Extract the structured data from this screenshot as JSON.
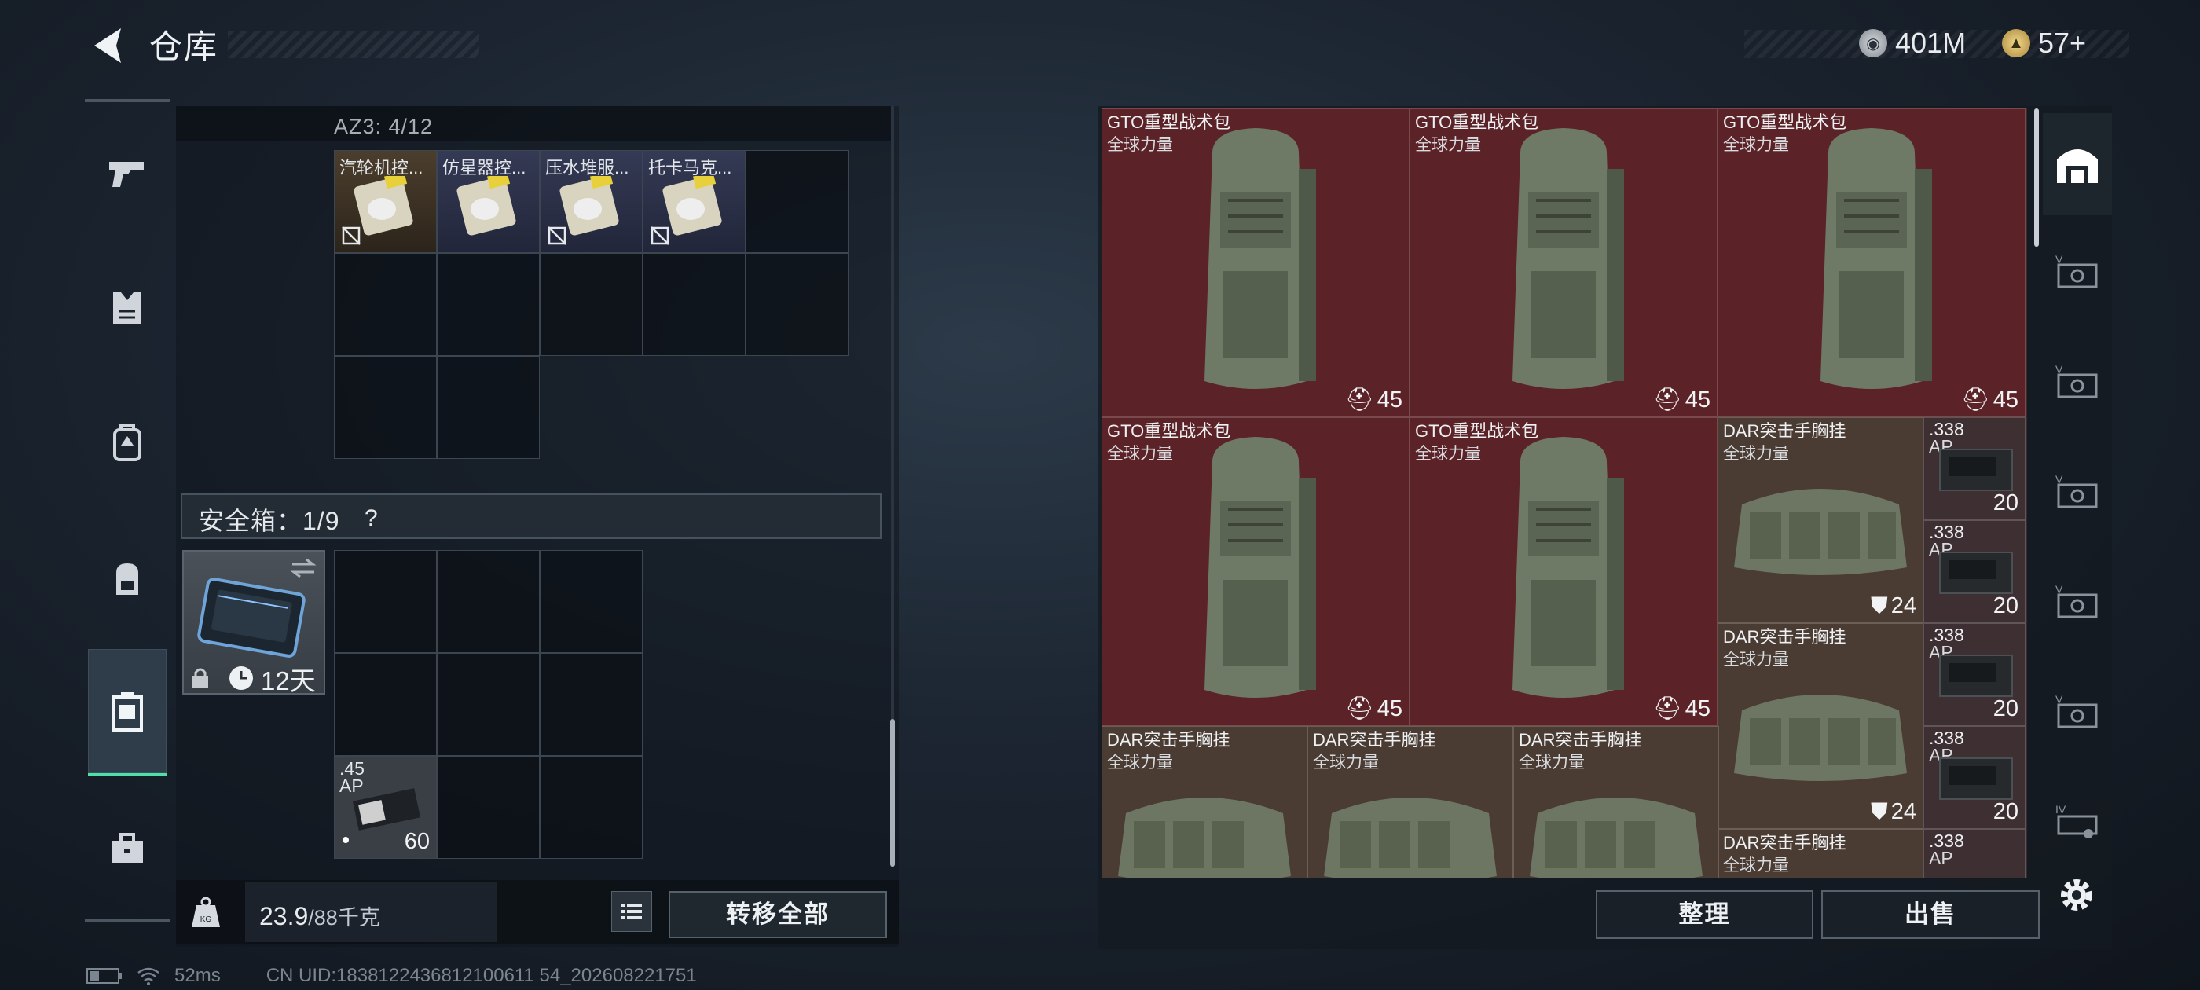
{
  "header": {
    "title": "仓库",
    "currency_coin": "401M",
    "currency_ticket": "57+"
  },
  "left_rail": {
    "items": [
      {
        "icon": "gun-icon"
      },
      {
        "icon": "vest-icon"
      },
      {
        "icon": "rig-icon"
      },
      {
        "icon": "backpack-icon"
      },
      {
        "icon": "case-icon",
        "active": true
      },
      {
        "icon": "toolbox-icon"
      }
    ]
  },
  "container": {
    "label": "AZ3: 4/12",
    "items": [
      {
        "name": "汽轮机控..."
      },
      {
        "name": "仿星器控..."
      },
      {
        "name": "压水堆服..."
      },
      {
        "name": "托卡马克..."
      }
    ]
  },
  "safebox": {
    "label": "安全箱：1/9",
    "help": "?",
    "days": "12天",
    "ammo_name": ".45",
    "ammo_sub": "AP",
    "ammo_count": "60"
  },
  "weight": {
    "current": "23.9",
    "max": "/88千克"
  },
  "buttons": {
    "transfer_all": "转移全部",
    "sort": "整理",
    "sell": "出售"
  },
  "stash": {
    "gto_name": "GTO重型战术包",
    "gto_sub": "全球力量",
    "gto_count": "45",
    "dar_name": "DAR突击手胸挂",
    "dar_sub": "全球力量",
    "dar_count": "24",
    "ammo_name": ".338",
    "ammo_sub": "AP",
    "ammo_count": "20"
  },
  "status_bar": {
    "ping": "52ms",
    "uid": "CN UID:1838122436812100611 54_202608221751"
  },
  "colors": {
    "accent": "#4ee0a8",
    "item_red": "#5b2328",
    "panel_bg": "#10161d"
  }
}
